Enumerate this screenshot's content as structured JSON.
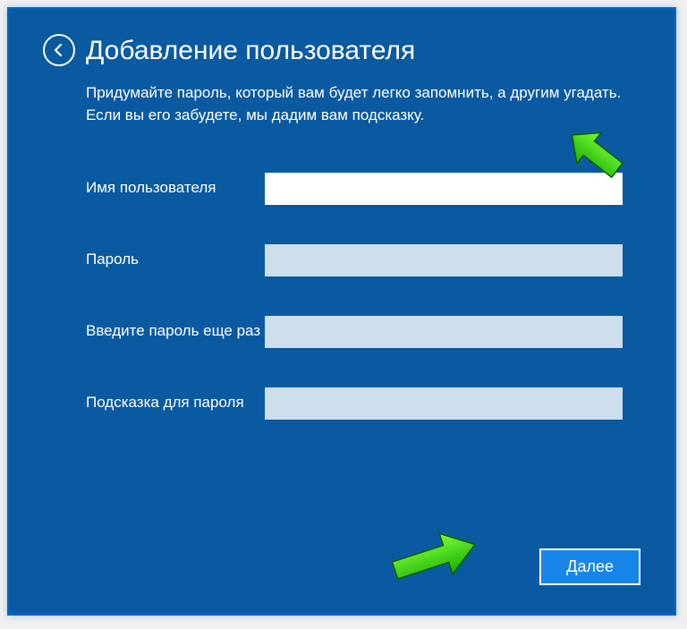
{
  "title": "Добавление пользователя",
  "description": "Придумайте пароль, который вам будет легко запомнить, а другим угадать. Если вы его забудете, мы дадим вам подсказку.",
  "fields": {
    "username_label": "Имя пользователя",
    "username_value": "",
    "password_label": "Пароль",
    "password_value": "",
    "confirm_label": "Введите пароль еще раз",
    "confirm_value": "",
    "hint_label": "Подсказка для пароля",
    "hint_value": ""
  },
  "buttons": {
    "next": "Далее"
  }
}
